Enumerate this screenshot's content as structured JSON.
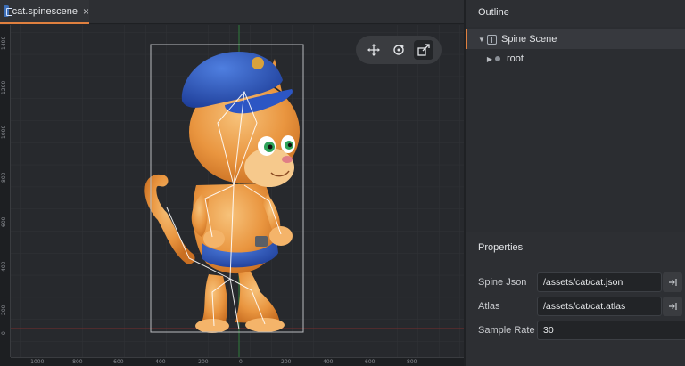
{
  "tab": {
    "label": "cat.spinescene",
    "close": "×"
  },
  "rulers": {
    "x_ticks": [
      "-1000",
      "-800",
      "-600",
      "-400",
      "-200",
      "0",
      "200",
      "400",
      "600",
      "800"
    ],
    "y_ticks": [
      "1400",
      "1200",
      "1000",
      "800",
      "600",
      "400",
      "200",
      "0"
    ]
  },
  "viewtools": {
    "items": [
      {
        "icon": "move-icon",
        "active": false
      },
      {
        "icon": "rotate-icon",
        "active": false
      },
      {
        "icon": "scale-icon",
        "active": true
      }
    ]
  },
  "outline": {
    "title": "Outline",
    "items": [
      {
        "label": "Spine Scene",
        "expanded": true,
        "icon": "spine-scene-icon"
      },
      {
        "label": "root",
        "expanded": false,
        "icon": "bone-icon"
      }
    ]
  },
  "properties": {
    "title": "Properties",
    "fields": [
      {
        "label": "Spine Json",
        "value": "/assets/cat/cat.json",
        "has_button": true
      },
      {
        "label": "Atlas",
        "value": "/assets/cat/cat.atlas",
        "has_button": true
      },
      {
        "label": "Sample Rate",
        "value": "30",
        "has_button": false
      }
    ]
  },
  "colors": {
    "accent": "#e0803f",
    "background": "#26282c",
    "panel": "#2d2f33",
    "x_axis": "#7a2d2d",
    "y_axis": "#2f7a3a"
  }
}
